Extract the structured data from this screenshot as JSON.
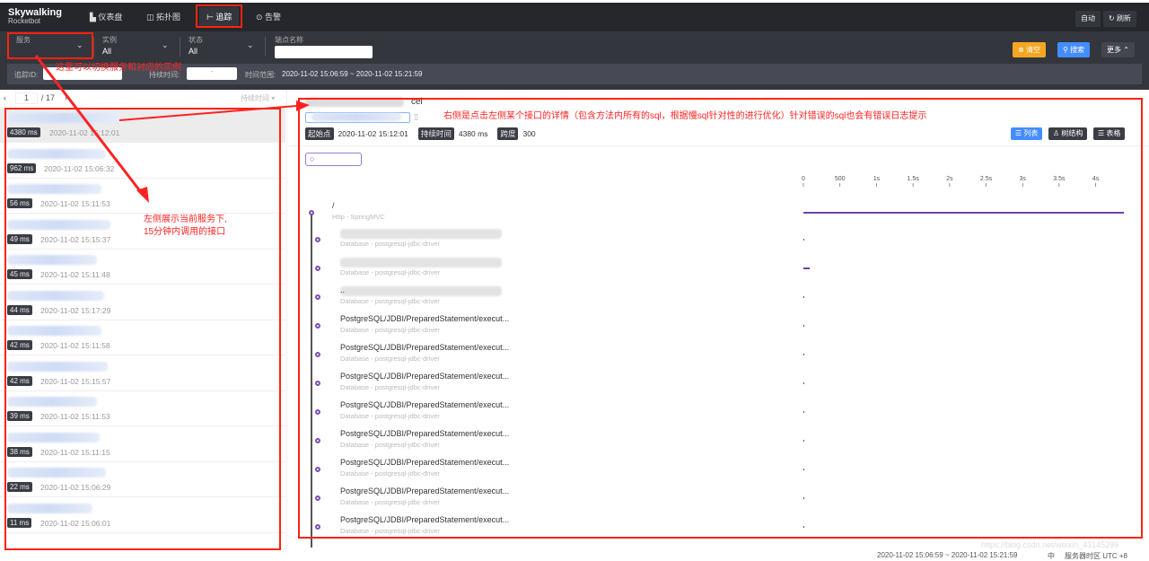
{
  "header": {
    "logo": "Skywalking",
    "logo_sub": "Rocketbot",
    "nav": [
      "仪表盘",
      "拓扑图",
      "追踪",
      "告警"
    ],
    "auto": "自动",
    "refresh": "刷新"
  },
  "filters": {
    "service_label": "服务",
    "service_value": "",
    "instance_label": "实例",
    "instance_value": "All",
    "status_label": "状态",
    "status_value": "All",
    "endpoint_label": "端点名称",
    "clear": "清空",
    "search": "搜索",
    "more": "更多",
    "trace_id_label": "追踪ID:",
    "duration_label": "持续时间:",
    "duration_sep": "-",
    "time_range_label": "时间范围:",
    "time_range": "2020-11-02 15:06:59 ~ 2020-11-02 15:21:59"
  },
  "pager": {
    "page": "1",
    "total": "/ 17",
    "sort": "持续时间"
  },
  "traces": [
    {
      "ms": "4380 ms",
      "time": "2020-11-02 15:12:01"
    },
    {
      "ms": "962 ms",
      "time": "2020-11-02 15:06:32"
    },
    {
      "ms": "56 ms",
      "time": "2020-11-02 15:11:53"
    },
    {
      "ms": "49 ms",
      "time": "2020-11-02 15:15:37"
    },
    {
      "ms": "45 ms",
      "time": "2020-11-02 15:11:48"
    },
    {
      "ms": "44 ms",
      "time": "2020-11-02 15:17:29"
    },
    {
      "ms": "42 ms",
      "time": "2020-11-02 15:11:58"
    },
    {
      "ms": "42 ms",
      "time": "2020-11-02 15:15:57"
    },
    {
      "ms": "39 ms",
      "time": "2020-11-02 15:11:53"
    },
    {
      "ms": "38 ms",
      "time": "2020-11-02 15:11:15"
    },
    {
      "ms": "22 ms",
      "time": "2020-11-02 15:06:29"
    },
    {
      "ms": "11 ms",
      "time": "2020-11-02 15:06:01"
    }
  ],
  "detail": {
    "title_suffix": "cel",
    "start_label": "起始点",
    "start": "2020-11-02 15:12:01",
    "duration_label": "持续时间",
    "duration": "4380 ms",
    "span_label": "跨度",
    "spans": "300",
    "view_list": "列表",
    "view_tree": "树结构",
    "view_table": "表格",
    "axis": [
      "0",
      "500",
      "1s",
      "1.5s",
      "2s",
      "2.5s",
      "3s",
      "3.5s",
      "4s"
    ],
    "root": {
      "title": "/",
      "sub": "Http - SpringMVC",
      "progress": 1.0
    },
    "rows": [
      {
        "title": "",
        "sub": "Database - postgresql-jdbc-driver"
      },
      {
        "title": "",
        "sub": "Database - postgresql-jdbc-driver"
      },
      {
        "title": "..",
        "sub": "Database - postgresql-jdbc-driver"
      },
      {
        "title": "PostgreSQL/JDBI/PreparedStatement/execut...",
        "sub": "Database - postgresql-jdbc-driver"
      },
      {
        "title": "PostgreSQL/JDBI/PreparedStatement/execut...",
        "sub": "Database - postgresql-jdbc-driver"
      },
      {
        "title": "PostgreSQL/JDBI/PreparedStatement/execut...",
        "sub": "Database - postgresql-jdbc-driver"
      },
      {
        "title": "PostgreSQL/JDBI/PreparedStatement/execut...",
        "sub": "Database - postgresql-jdbc-driver"
      },
      {
        "title": "PostgreSQL/JDBI/PreparedStatement/execut...",
        "sub": "Database - postgresql-jdbc-driver"
      },
      {
        "title": "PostgreSQL/JDBI/PreparedStatement/execut...",
        "sub": "Database - postgresql-jdbc-driver"
      },
      {
        "title": "PostgreSQL/JDBI/PreparedStatement/execut...",
        "sub": "Database - postgresql-jdbc-driver"
      },
      {
        "title": "PostgreSQL/JDBI/PreparedStatement/execut...",
        "sub": "Database - postgresql-jdbc-driver"
      }
    ]
  },
  "status": {
    "range": "2020-11-02 15:06:59 ~ 2020-11-02 15:21:59",
    "lang": "中",
    "tz": "服务器时区 UTC +8",
    "watermark": "https://blog.csdn.net/weixin_43145299"
  },
  "annotations": {
    "service": "这里可以切换服务和对应的实例",
    "left": "左侧展示当前服务下,",
    "left2": "15分钟内调用的接口",
    "right": "右侧是点击左侧某个接口的详情（包含方法内所有的sql，根据慢sql针对性的进行优化）针对错误的sql也会有错误日志提示"
  }
}
